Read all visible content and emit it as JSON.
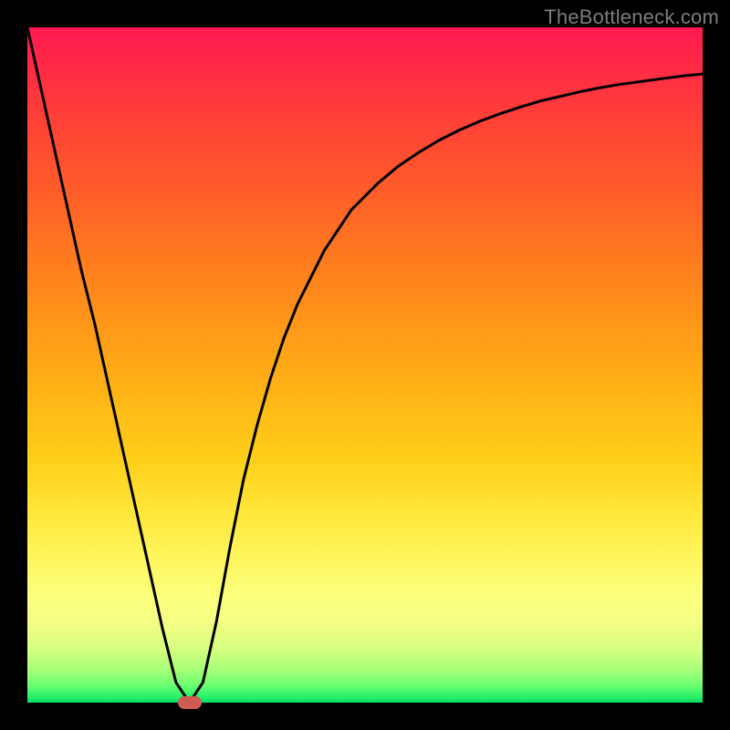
{
  "watermark": "TheBottleneck.com",
  "colors": {
    "background": "#000000",
    "watermark": "#7c7c7c",
    "curve": "#000000",
    "marker": "#cf5c53"
  },
  "chart_data": {
    "type": "line",
    "title": "",
    "xlabel": "",
    "ylabel": "",
    "xlim": [
      0,
      100
    ],
    "ylim": [
      0,
      100
    ],
    "x": [
      0,
      2,
      4,
      6,
      8,
      10,
      12,
      14,
      16,
      18,
      20,
      22,
      24,
      26,
      28,
      30,
      32,
      34,
      36,
      38,
      40,
      42,
      44,
      46,
      48,
      50,
      52,
      55,
      58,
      61,
      64,
      67,
      70,
      73,
      76,
      79,
      82,
      85,
      88,
      91,
      94,
      97,
      100
    ],
    "values": [
      100,
      91,
      82,
      73,
      64,
      56,
      47,
      38,
      29,
      20,
      11,
      3,
      0,
      3,
      12,
      23,
      33,
      41,
      48,
      54,
      59,
      63,
      67,
      70,
      73,
      75,
      77,
      79.5,
      81.5,
      83.3,
      84.8,
      86.1,
      87.2,
      88.2,
      89.1,
      89.8,
      90.5,
      91.1,
      91.6,
      92,
      92.4,
      92.8,
      93.1
    ],
    "minimum": {
      "x": 24,
      "y": 0
    },
    "grid": false,
    "legend": false
  }
}
